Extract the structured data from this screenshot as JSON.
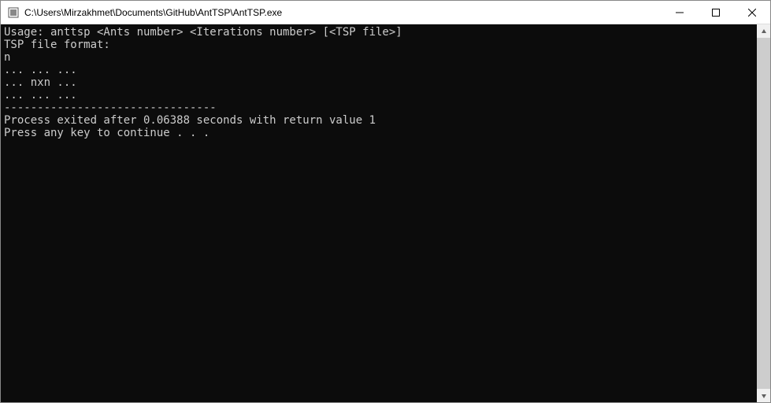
{
  "window": {
    "title": "C:\\Users\\Mirzakhmet\\Documents\\GitHub\\AntTSP\\AntTSP.exe"
  },
  "console": {
    "lines": [
      "Usage: anttsp <Ants number> <Iterations number> [<TSP file>]",
      "TSP file format:",
      "n",
      "... ... ...",
      "... nxn ...",
      "... ... ...",
      "--------------------------------",
      "Process exited after 0.06388 seconds with return value 1",
      "Press any key to continue . . ."
    ]
  }
}
